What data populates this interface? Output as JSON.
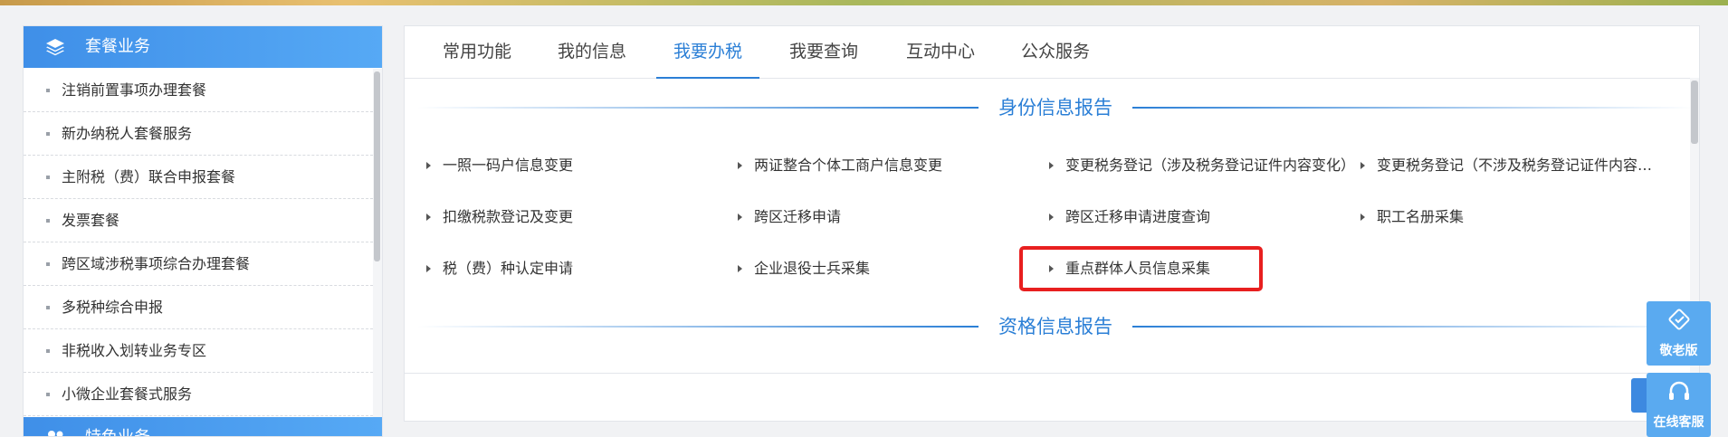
{
  "left_panel": {
    "header": "套餐业务",
    "items": [
      "注销前置事项办理套餐",
      "新办纳税人套餐服务",
      "主附税（费）联合申报套餐",
      "发票套餐",
      "跨区域涉税事项综合办理套餐",
      "多税种综合申报",
      "非税收入划转业务专区",
      "小微企业套餐式服务"
    ],
    "second_header": "特色业务"
  },
  "tabs": [
    "常用功能",
    "我的信息",
    "我要办税",
    "我要查询",
    "互动中心",
    "公众服务"
  ],
  "active_tab": "我要办税",
  "sections": [
    {
      "title": "身份信息报告",
      "items": [
        "一照一码户信息变更",
        "两证整合个体工商户信息变更",
        "变更税务登记（涉及税务登记证件内容变化）",
        "变更税务登记（不涉及税务登记证件内容变化）",
        "扣缴税款登记及变更",
        "跨区迁移申请",
        "跨区迁移申请进度查询",
        "职工名册采集",
        "税（费）种认定申请",
        "企业退役士兵采集",
        "重点群体人员信息采集"
      ]
    },
    {
      "title": "资格信息报告"
    }
  ],
  "highlighted_item": "重点群体人员信息采集",
  "float_buttons": [
    "敬老版",
    "在线客服"
  ],
  "colors": {
    "accent": "#2b7fd6",
    "header_blue": "#4a9cf0",
    "highlight_red": "#e81f1f",
    "float_blue": "#5aaaf0"
  },
  "icons": [
    "layers-icon",
    "people-icon",
    "hand-heart-icon",
    "headset-icon",
    "bullet-arrow-icon"
  ]
}
